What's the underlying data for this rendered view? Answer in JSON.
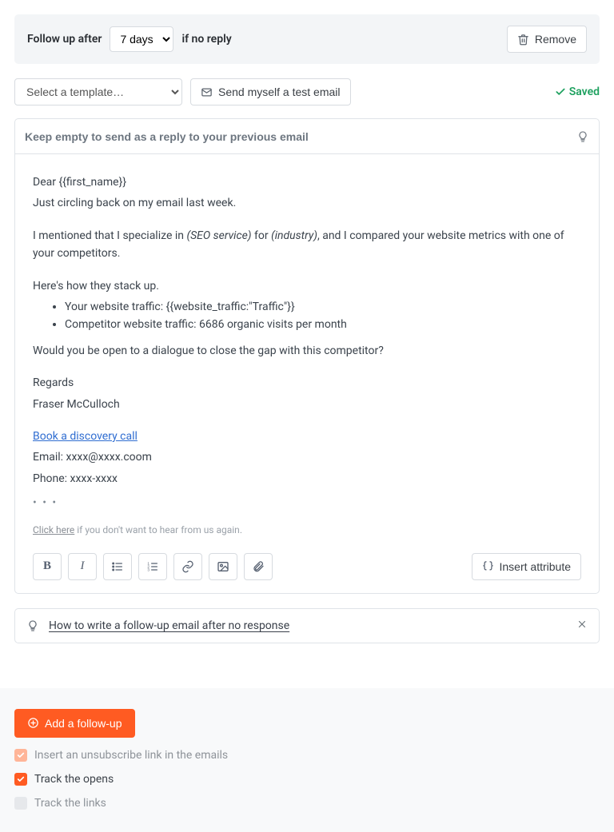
{
  "header": {
    "follow_up_prefix": "Follow up after",
    "follow_up_suffix": "if no reply",
    "days_options": [
      "7 days"
    ],
    "days_selected": "7 days",
    "remove_label": "Remove"
  },
  "tools": {
    "template_placeholder": "Select a template…",
    "send_test_label": "Send myself a test email",
    "saved_label": "Saved"
  },
  "subject": {
    "placeholder": "Keep empty to send as a reply to your previous email"
  },
  "body": {
    "greeting": "Dear {{first_name}}",
    "line1": "Just circling back on my email last week.",
    "para2_a": "I mentioned that I specialize in ",
    "para2_em1": "(SEO service)",
    "para2_b": " for ",
    "para2_em2": "(industry)",
    "para2_c": ", and I compared your website metrics with one of your competitors.",
    "stack_intro": "Here's how they stack up.",
    "bullet1": "Your website traffic: {{website_traffic:\"Traffic\"}}",
    "bullet2": "Competitor website traffic: 6686 organic visits  per month",
    "closing_q": "Would you be open to a dialogue to close the gap with this competitor?",
    "regards": "Regards",
    "sender": "Fraser McCulloch",
    "book_call": "Book a discovery call",
    "email_line": "Email: xxxx@xxxx.coom",
    "phone_line": "Phone: xxxx-xxxx",
    "dots": "• • •",
    "unsub_click": "Click here",
    "unsub_rest": " if you don't want to hear from us again."
  },
  "toolbar": {
    "insert_attribute": "Insert attribute"
  },
  "tip": {
    "text": "How to write a follow-up email after no response"
  },
  "footer": {
    "add_followup": "Add a follow-up",
    "opt_unsubscribe": "Insert an unsubscribe link in the emails",
    "opt_track_opens": "Track the opens",
    "opt_track_links": "Track the links"
  }
}
